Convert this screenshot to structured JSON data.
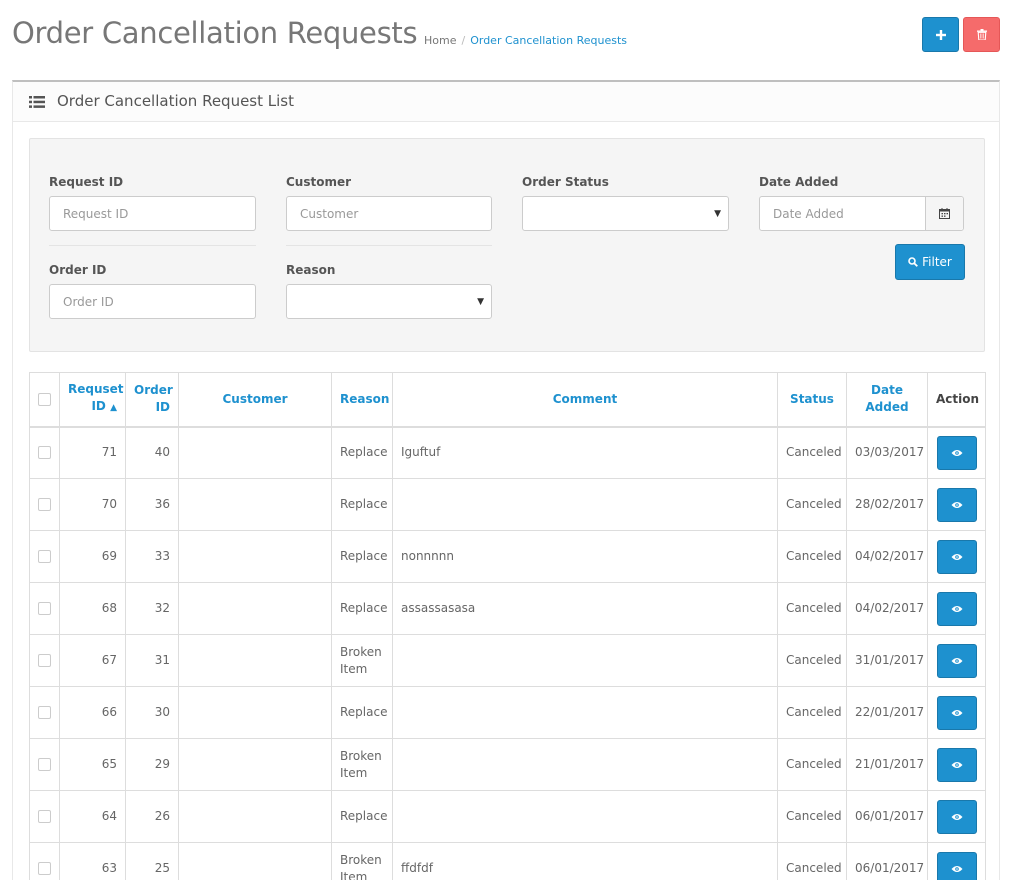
{
  "header": {
    "title": "Order Cancellation Requests",
    "breadcrumb": [
      "Home",
      "Order Cancellation Requests"
    ],
    "add_icon": "plus-icon",
    "delete_icon": "trash-icon"
  },
  "panel": {
    "title": "Order Cancellation Request List",
    "icon": "list-icon"
  },
  "filter": {
    "request_id_label": "Request ID",
    "request_id_placeholder": "Request ID",
    "customer_label": "Customer",
    "customer_placeholder": "Customer",
    "order_status_label": "Order Status",
    "order_status_value": "",
    "date_added_label": "Date Added",
    "date_added_placeholder": "Date Added",
    "order_id_label": "Order ID",
    "order_id_placeholder": "Order ID",
    "reason_label": "Reason",
    "reason_value": "",
    "filter_button": "Filter"
  },
  "table": {
    "headers": {
      "request_id_1": "Requset",
      "request_id_2": "ID",
      "order_id_1": "Order",
      "order_id_2": "ID",
      "customer": "Customer",
      "reason": "Reason",
      "comment": "Comment",
      "status": "Status",
      "date_1": "Date",
      "date_2": "Added",
      "action": "Action"
    },
    "rows": [
      {
        "request_id": "71",
        "order_id": "40",
        "customer": "",
        "reason": "Replace",
        "comment": "Iguftuf",
        "status": "Canceled",
        "date": "03/03/2017"
      },
      {
        "request_id": "70",
        "order_id": "36",
        "customer": "",
        "reason": "Replace",
        "comment": "",
        "status": "Canceled",
        "date": "28/02/2017"
      },
      {
        "request_id": "69",
        "order_id": "33",
        "customer": "",
        "reason": "Replace",
        "comment": "nonnnnn",
        "status": "Canceled",
        "date": "04/02/2017"
      },
      {
        "request_id": "68",
        "order_id": "32",
        "customer": "",
        "reason": "Replace",
        "comment": "assassasasa",
        "status": "Canceled",
        "date": "04/02/2017"
      },
      {
        "request_id": "67",
        "order_id": "31",
        "customer": "",
        "reason": "Broken Item",
        "comment": "",
        "status": "Canceled",
        "date": "31/01/2017"
      },
      {
        "request_id": "66",
        "order_id": "30",
        "customer": "",
        "reason": "Replace",
        "comment": "",
        "status": "Canceled",
        "date": "22/01/2017"
      },
      {
        "request_id": "65",
        "order_id": "29",
        "customer": "",
        "reason": "Broken Item",
        "comment": "",
        "status": "Canceled",
        "date": "21/01/2017"
      },
      {
        "request_id": "64",
        "order_id": "26",
        "customer": "",
        "reason": "Replace",
        "comment": "",
        "status": "Canceled",
        "date": "06/01/2017"
      },
      {
        "request_id": "63",
        "order_id": "25",
        "customer": "",
        "reason": "Broken Item",
        "comment": "ffdfdf",
        "status": "Canceled",
        "date": "06/01/2017"
      }
    ]
  },
  "colors": {
    "primary": "#1e91cf",
    "danger": "#f56b6b"
  }
}
